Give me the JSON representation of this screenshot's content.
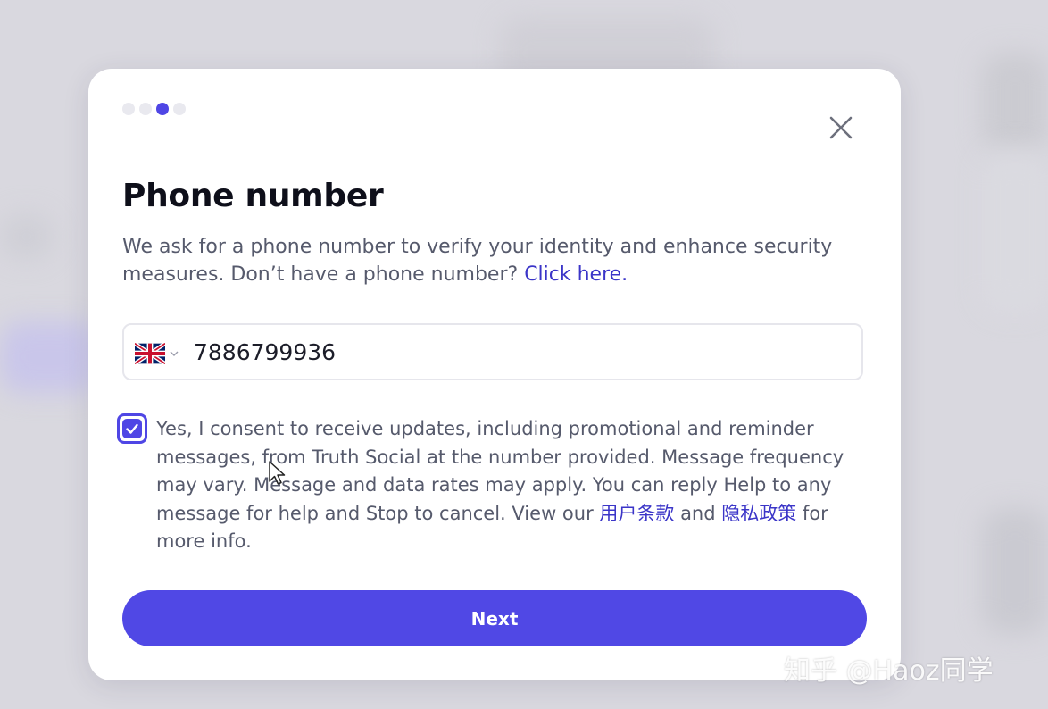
{
  "dialog": {
    "title": "Phone number",
    "description": "We ask for a phone number to verify your identity and enhance security measures. Don’t have a phone number? ",
    "click_here_link": "Click here.",
    "progress": {
      "current_step": 3,
      "total_steps": 4
    },
    "phone": {
      "country_flag": "uk-flag-icon",
      "value": "7886799936"
    },
    "consent": {
      "checked": true,
      "text_part1": "Yes, I consent to receive updates, including promotional and reminder messages, from Truth Social at the number provided. Message frequency may vary. Message and data rates may apply. You can reply Help to any message for help and Stop to cancel. View our ",
      "terms_link": "用户条款",
      "and_text": " and ",
      "privacy_link": "隐私政策",
      "text_part2": " for more info."
    },
    "next_button": "Next",
    "colors": {
      "accent": "#5048e5",
      "link": "#3b35c8",
      "text": "#565a6c",
      "title": "#0e0f1a"
    }
  },
  "watermark": "知乎 @Haoz同学"
}
